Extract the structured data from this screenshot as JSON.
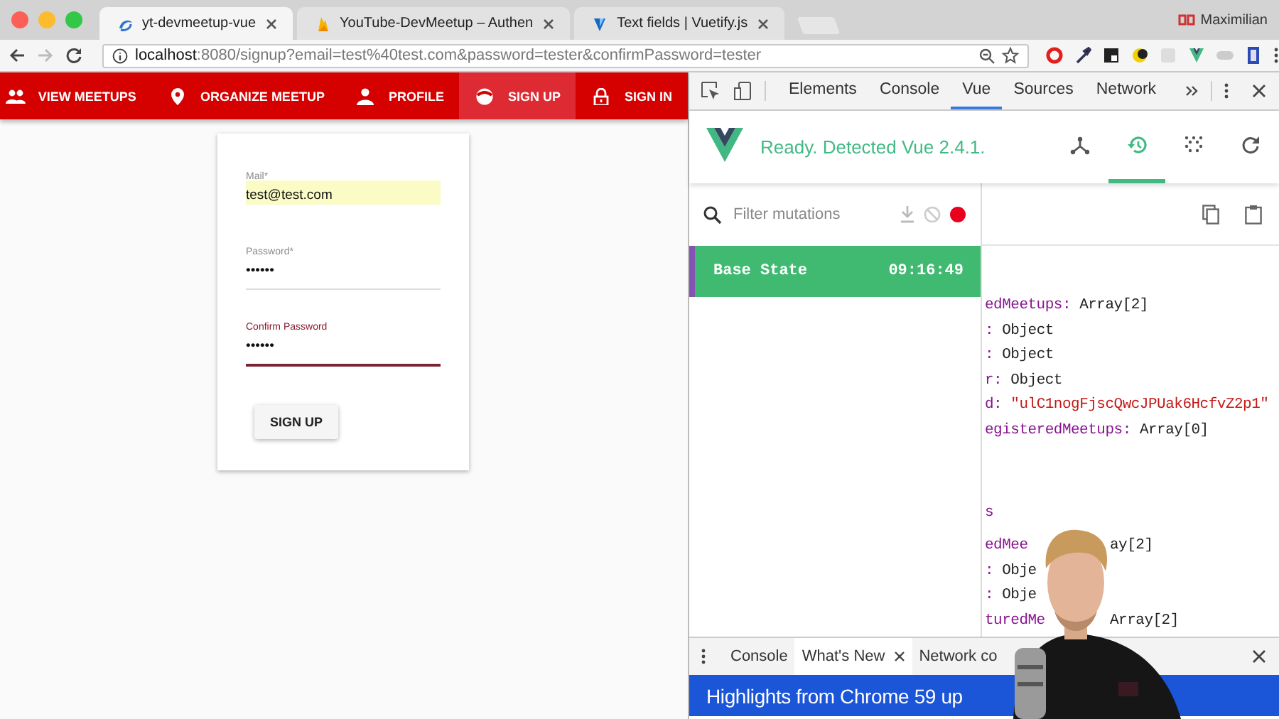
{
  "browser": {
    "tabs": [
      {
        "title": "yt-devmeetup-vue",
        "selected": true
      },
      {
        "title": "YouTube-DevMeetup – Authen",
        "selected": false
      },
      {
        "title": "Text fields | Vuetify.js",
        "selected": false
      }
    ],
    "profile": "Maximilian",
    "url_host": "localhost",
    "url_path": ":8080/signup?email=test%40test.com&password=tester&confirmPassword=tester"
  },
  "app": {
    "nav": [
      {
        "label": "VIEW MEETUPS",
        "selected": false
      },
      {
        "label": "ORGANIZE MEETUP",
        "selected": false
      },
      {
        "label": "PROFILE",
        "selected": false
      },
      {
        "label": "SIGN UP",
        "selected": true
      },
      {
        "label": "SIGN IN",
        "selected": false
      }
    ],
    "form": {
      "fields": [
        {
          "label": "Mail*",
          "value": "test@test.com",
          "autofilled": true,
          "focused": false
        },
        {
          "label": "Password*",
          "value": "••••••",
          "autofilled": false,
          "focused": false
        },
        {
          "label": "Confirm Password",
          "value": "••••••",
          "autofilled": false,
          "focused": true
        }
      ],
      "button": "SIGN UP"
    }
  },
  "devtools": {
    "tabs": [
      {
        "label": "Elements",
        "selected": false
      },
      {
        "label": "Console",
        "selected": false
      },
      {
        "label": "Vue",
        "selected": true
      },
      {
        "label": "Sources",
        "selected": false
      },
      {
        "label": "Network",
        "selected": false
      }
    ],
    "vue": {
      "status": "Ready. Detected Vue 2.4.1.",
      "tools": [
        {
          "selected": false
        },
        {
          "selected": true
        },
        {
          "selected": false
        },
        {
          "selected": false
        }
      ],
      "filter": {
        "placeholder": "Filter mutations"
      },
      "recording": true,
      "mutations": [
        {
          "name": "Base State",
          "time": "09:16:49",
          "selected": true
        }
      ],
      "state": [
        {
          "lines": [
            {
              "key": "edMeetups:",
              "value": "Array[2]",
              "kind": "plain"
            },
            {
              "key": ":",
              "value": "Object",
              "kind": "plain"
            },
            {
              "key": ":",
              "value": "Object",
              "kind": "plain"
            },
            {
              "key": "r:",
              "value": "Object",
              "kind": "plain"
            },
            {
              "key": "d:",
              "value": "\"ulC1nogFjscQwcJPUak6HcfvZ2p1\"",
              "kind": "string"
            },
            {
              "key": "egisteredMeetups:",
              "value": "Array[0]",
              "kind": "plain"
            }
          ]
        },
        {
          "heading": "s",
          "lines": [
            {
              "key": "edMee",
              "tail": "ay[2]"
            },
            {
              "key": ":",
              "value": "Obje",
              "kind": "plain"
            },
            {
              "key": ":",
              "value": "Obje",
              "kind": "plain"
            },
            {
              "key": "turedMe",
              "tail": "Array[2]"
            }
          ]
        }
      ]
    },
    "drawer": {
      "tabs": [
        {
          "label": "Console",
          "selected": false
        },
        {
          "label": "What's New",
          "selected": true
        },
        {
          "label": "Network co",
          "selected": false
        }
      ],
      "banner": "Highlights from Chrome 59 up"
    }
  }
}
